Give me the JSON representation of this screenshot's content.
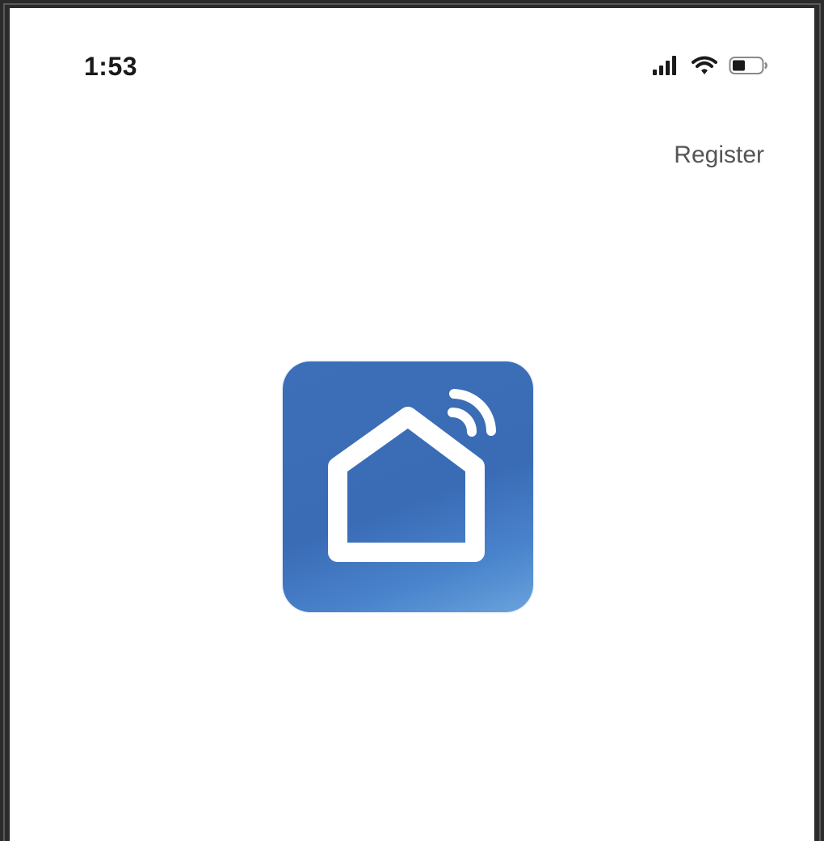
{
  "status_bar": {
    "time": "1:53",
    "signal_icon": "cellular-signal-icon",
    "wifi_icon": "wifi-icon",
    "battery_icon": "battery-icon"
  },
  "header": {
    "register_label": "Register"
  },
  "logo": {
    "icon": "smart-home-icon",
    "brand_color": "#3a6cb6",
    "accent_color": "#ffffff"
  },
  "theme": {
    "frame_color": "#2b2b2b",
    "background": "#ffffff",
    "text_primary": "#1a1a1a",
    "text_secondary": "#555555"
  }
}
